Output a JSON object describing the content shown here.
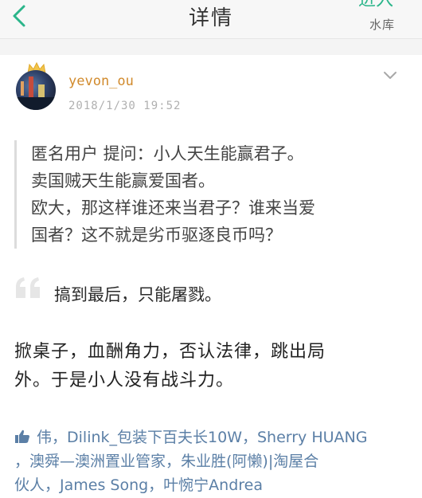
{
  "header": {
    "title": "详情",
    "enter_label": "进入",
    "library_label": "水库"
  },
  "post": {
    "username": "yevon_ou",
    "date": "2018/1/30 19:52"
  },
  "quote_lines": [
    "匿名用户 提问：小人天生能赢君子。",
    "卖国贼天生能赢爱国者。",
    "欧大，那这样谁还来当君子？谁来当爱",
    "国者？这不就是劣币驱逐良币吗？"
  ],
  "answer": {
    "first_line": "搞到最后，只能屠戮。",
    "lines": [
      "掀桌子，血酬角力，否认法律，跳出局",
      "外。于是小人没有战斗力。"
    ]
  },
  "likes": {
    "lines": [
      "伟，Dilink_包装下百夫长10W，Sherry HUANG",
      "，澳舜—澳洲置业管家，朱业胜(阿懒)|淘屋合",
      "伙人，James Song，叶惋宁Andrea"
    ]
  },
  "colors": {
    "accent": "#2bb58a",
    "username": "#d18a2c",
    "likes": "#5b7fa6"
  }
}
